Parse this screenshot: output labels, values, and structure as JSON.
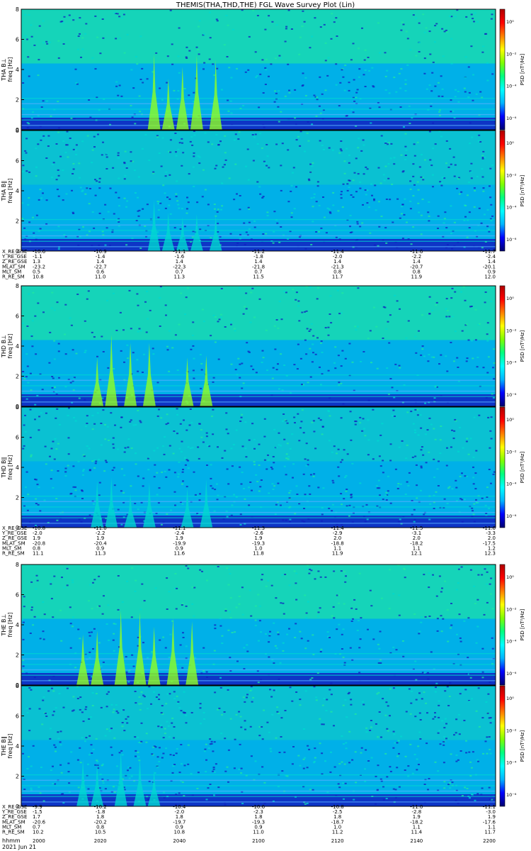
{
  "title": "THEMIS(THA,THD,THE) FGL Wave Survey Plot (Lin)",
  "footer": {
    "time_label": "hhmm",
    "date_label": "2021 Jun 21"
  },
  "chart_data": {
    "type": "heatmap",
    "title": "THEMIS(THA,THD,THE) FGL Wave Survey Plot (Lin)",
    "xlabel": "hhmm",
    "x_time_ticks": [
      "2000",
      "2020",
      "2040",
      "2100",
      "2120",
      "2140",
      "2200"
    ],
    "ylim": [
      0,
      8
    ],
    "y_ticks": [
      0,
      2,
      4,
      6,
      8
    ],
    "colorbar": {
      "label": "PSD [nT²/Hz]",
      "ticks": [
        "10⁰",
        "10⁻²",
        "10⁻⁴",
        "10⁻⁶"
      ],
      "colors": [
        "#000070",
        "#0000ff",
        "#00b4ff",
        "#00ffff",
        "#00ff80",
        "#80ff00",
        "#ffff00",
        "#ff8000",
        "#ff0000",
        "#b00000"
      ]
    },
    "colors": {
      "background": "#00b0e8",
      "deep": "#1020c0",
      "teal": "#00d8d0",
      "burst": "#90ff20",
      "upper": "#20e8a0"
    },
    "probes": [
      {
        "id": "THA",
        "panels": [
          {
            "ylabel": "THA B⊥",
            "sub": "freq [Hz]",
            "type": "perp",
            "bursts": [
              0.28,
              0.31,
              0.34,
              0.37,
              0.41
            ]
          },
          {
            "ylabel": "THA B∥",
            "sub": "freq [Hz]",
            "type": "par",
            "bursts": [
              0.28,
              0.31,
              0.34,
              0.37,
              0.41
            ]
          }
        ],
        "ephemeris": [
          {
            "label": "X_RE_GSE",
            "values": [
              "-10.6",
              "-10.9",
              "-11.1",
              "-11.2",
              "-11.4",
              "-11.6",
              "-11.7"
            ]
          },
          {
            "label": "Y_RE_GSE",
            "values": [
              "-1.1",
              "-1.4",
              "-1.6",
              "-1.8",
              "-2.0",
              "-2.2",
              "-2.4"
            ]
          },
          {
            "label": "Z_RE_GSE",
            "values": [
              "1.3",
              "1.4",
              "1.4",
              "1.4",
              "1.4",
              "1.4",
              "1.4"
            ]
          },
          {
            "label": "MLAT_SM",
            "values": [
              "-23.2",
              "-22.7",
              "-22.3",
              "-21.8",
              "-21.3",
              "-20.7",
              "-20.1"
            ]
          },
          {
            "label": "MLT_SM",
            "values": [
              "0.5",
              "0.6",
              "0.7",
              "0.7",
              "0.8",
              "0.8",
              "0.9"
            ]
          },
          {
            "label": "R_RE_SM",
            "values": [
              "10.8",
              "11.0",
              "11.3",
              "11.5",
              "11.7",
              "11.9",
              "12.0"
            ]
          }
        ]
      },
      {
        "id": "THD",
        "panels": [
          {
            "ylabel": "THD B⊥",
            "sub": "freq [Hz]",
            "type": "perp",
            "bursts": [
              0.16,
              0.19,
              0.23,
              0.27,
              0.35,
              0.39
            ]
          },
          {
            "ylabel": "THD B∥",
            "sub": "freq [Hz]",
            "type": "par",
            "bursts": [
              0.16,
              0.19,
              0.23,
              0.27,
              0.35,
              0.39
            ]
          }
        ],
        "ephemeris": [
          {
            "label": "X_RE_GSE",
            "values": [
              "-10.8",
              "-11.0",
              "-11.1",
              "-11.3",
              "-11.4",
              "-11.5",
              "-11.6"
            ]
          },
          {
            "label": "Y_RE_GSE",
            "values": [
              "-2.0",
              "-2.2",
              "-2.4",
              "-2.6",
              "-2.9",
              "-3.1",
              "-3.3"
            ]
          },
          {
            "label": "Z_RE_GSE",
            "values": [
              "1.9",
              "1.9",
              "1.9",
              "1.9",
              "2.0",
              "2.0",
              "2.0"
            ]
          },
          {
            "label": "MLAT_SM",
            "values": [
              "-20.8",
              "-20.4",
              "-19.9",
              "-19.3",
              "-18.8",
              "-18.2",
              "-17.5"
            ]
          },
          {
            "label": "MLT_SM",
            "values": [
              "0.8",
              "0.9",
              "0.9",
              "1.0",
              "1.1",
              "1.1",
              "1.2"
            ]
          },
          {
            "label": "R_RE_SM",
            "values": [
              "11.1",
              "11.3",
              "11.6",
              "11.8",
              "11.9",
              "12.1",
              "12.3"
            ]
          }
        ]
      },
      {
        "id": "THE",
        "panels": [
          {
            "ylabel": "THE B⊥",
            "sub": "freq [Hz]",
            "type": "perp",
            "bursts": [
              0.13,
              0.16,
              0.21,
              0.25,
              0.28,
              0.32,
              0.36
            ]
          },
          {
            "ylabel": "THE B∥",
            "sub": "freq [Hz]",
            "type": "par",
            "bursts": [
              0.13,
              0.16,
              0.21,
              0.25,
              0.28
            ]
          }
        ],
        "ephemeris": [
          {
            "label": "X_RE_GSE",
            "values": [
              "-9.9",
              "-10.2",
              "-10.4",
              "-10.6",
              "-10.8",
              "-11.0",
              "-11.1"
            ]
          },
          {
            "label": "Y_RE_GSE",
            "values": [
              "-1.5",
              "-1.8",
              "-2.0",
              "-2.3",
              "-2.5",
              "-2.8",
              "-3.0"
            ]
          },
          {
            "label": "Z_RE_GSE",
            "values": [
              "1.7",
              "1.8",
              "1.8",
              "1.8",
              "1.8",
              "1.9",
              "1.9"
            ]
          },
          {
            "label": "MLAT_SM",
            "values": [
              "-20.6",
              "-20.2",
              "-19.7",
              "-19.3",
              "-18.7",
              "-18.2",
              "-17.6"
            ]
          },
          {
            "label": "MLT_SM",
            "values": [
              "0.7",
              "0.8",
              "0.9",
              "0.9",
              "1.0",
              "1.1",
              "1.1"
            ]
          },
          {
            "label": "R_RE_SM",
            "values": [
              "10.2",
              "10.5",
              "10.8",
              "11.0",
              "11.2",
              "11.4",
              "11.7"
            ]
          }
        ]
      }
    ]
  }
}
